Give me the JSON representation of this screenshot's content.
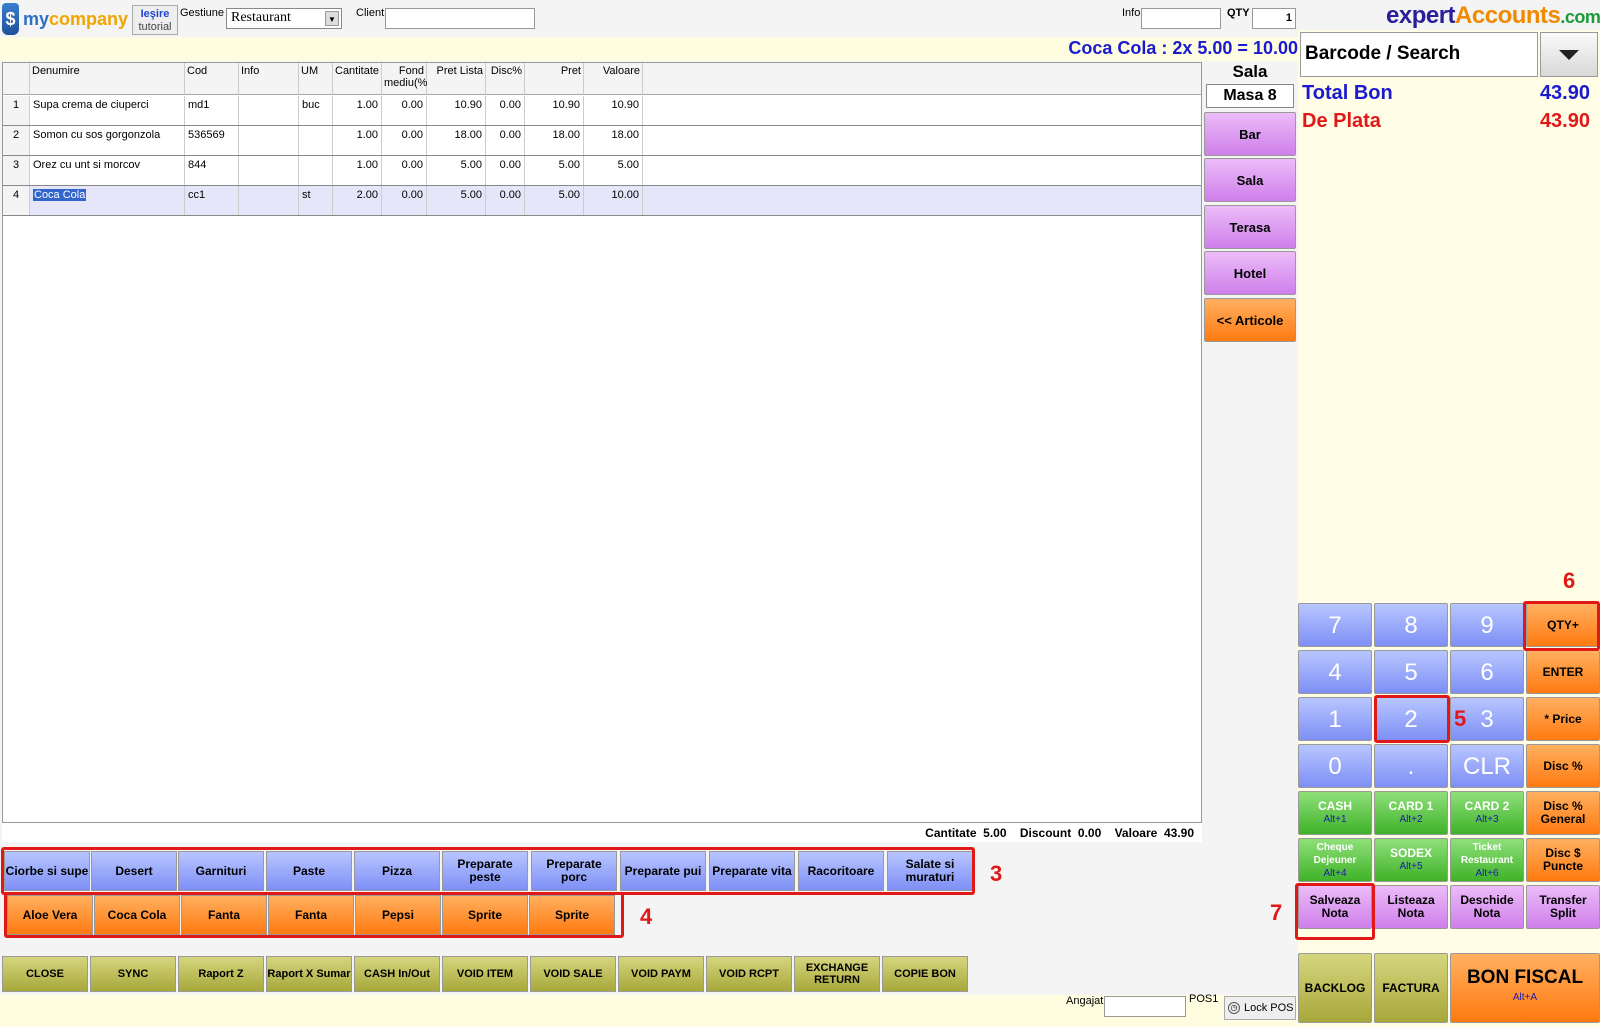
{
  "header": {
    "logo_text_a": "my",
    "logo_text_b": "company",
    "tutorial_line1": "Ieşire",
    "tutorial_line2": "tutorial",
    "gestiune_label": "Gestiune",
    "gestiune_value": "Restaurant",
    "client_label": "Client",
    "client_value": "",
    "info_label": "Info",
    "info_value": "",
    "qty_label": "QTY",
    "qty_value": "1",
    "brand_a": "expert",
    "brand_b": "Accounts",
    "brand_c": ".com",
    "last_item": "Coca Cola : 2x 5.00 = 10.00"
  },
  "grid": {
    "columns": [
      "Denumire",
      "Cod",
      "Info",
      "UM",
      "Cantitate",
      "Fond mediu(%",
      "Pret Lista",
      "Disc%",
      "Pret",
      "Valoare"
    ],
    "rows": [
      {
        "n": "1",
        "denumire": "Supa crema de ciuperci",
        "cod": "md1",
        "info": "",
        "um": "buc",
        "cant": "1.00",
        "fond": "0.00",
        "pret_lista": "10.90",
        "disc": "0.00",
        "pret": "10.90",
        "valoare": "10.90"
      },
      {
        "n": "2",
        "denumire": "Somon cu sos gorgonzola",
        "cod": "536569",
        "info": "",
        "um": "",
        "cant": "1.00",
        "fond": "0.00",
        "pret_lista": "18.00",
        "disc": "0.00",
        "pret": "18.00",
        "valoare": "18.00"
      },
      {
        "n": "3",
        "denumire": "Orez cu unt si morcov",
        "cod": "844",
        "info": "",
        "um": "",
        "cant": "1.00",
        "fond": "0.00",
        "pret_lista": "5.00",
        "disc": "0.00",
        "pret": "5.00",
        "valoare": "5.00"
      },
      {
        "n": "4",
        "denumire": "Coca Cola",
        "cod": "cc1",
        "info": "",
        "um": "st",
        "cant": "2.00",
        "fond": "0.00",
        "pret_lista": "5.00",
        "disc": "0.00",
        "pret": "5.00",
        "valoare": "10.00"
      }
    ],
    "footer": {
      "cant_label": "Cantitate",
      "cant": "5.00",
      "disc_label": "Discount",
      "disc": "0.00",
      "val_label": "Valoare",
      "val": "43.90"
    }
  },
  "sala": {
    "title": "Sala",
    "masa": "Masa 8",
    "buttons": [
      "Bar",
      "Sala",
      "Terasa",
      "Hotel"
    ],
    "articole": "<< Articole"
  },
  "search": {
    "label": "Barcode / Search"
  },
  "totals": {
    "total_label": "Total Bon",
    "total": "43.90",
    "plata_label": "De Plata",
    "plata": "43.90",
    "total_color": "#1a1ad0",
    "plata_color": "#e01818"
  },
  "keypad": {
    "digits": [
      "7",
      "8",
      "9",
      "4",
      "5",
      "6",
      "1",
      "2",
      "3",
      "0",
      ".",
      "CLR"
    ],
    "qty_plus": "QTY+",
    "enter": "ENTER",
    "price": "* Price",
    "disc_pct": "Disc %",
    "disc_general": "Disc % General",
    "disc_puncte": "Disc $ Puncte",
    "cash": "CASH",
    "cash_key": "Alt+1",
    "card1": "CARD 1",
    "card1_key": "Alt+2",
    "card2": "CARD 2",
    "card2_key": "Alt+3",
    "cheque": "Cheque Dejeuner",
    "cheque_key": "Alt+4",
    "sodex": "SODEX",
    "sodex_key": "Alt+5",
    "ticket": "Ticket Restaurant",
    "ticket_key": "Alt+6",
    "salveaza": "Salveaza Nota",
    "listeaza": "Listeaza Nota",
    "deschide": "Deschide Nota",
    "transfer": "Transfer Split",
    "backlog": "BACKLOG",
    "factura": "FACTURA",
    "bon_fiscal": "BON FISCAL",
    "bon_key": "Alt+A"
  },
  "categories": [
    "Ciorbe si supe",
    "Desert",
    "Garnituri",
    "Paste",
    "Pizza",
    "Preparate peste",
    "Preparate porc",
    "Preparate pui",
    "Preparate vita",
    "Racoritoare",
    "Salate si muraturi"
  ],
  "products": [
    "Aloe Vera",
    "Coca Cola",
    "Fanta",
    "Fanta",
    "Pepsi",
    "Sprite",
    "Sprite"
  ],
  "functions": [
    "CLOSE",
    "SYNC",
    "Raport Z",
    "Raport X Sumar",
    "CASH In/Out",
    "VOID ITEM",
    "VOID SALE",
    "VOID PAYM",
    "VOID RCPT",
    "EXCHANGE RETURN",
    "COPIE BON"
  ],
  "bottom": {
    "angajat_label": "Angajat",
    "angajat_value": "",
    "pos": "POS1",
    "lock": "Lock POS"
  },
  "markers": [
    "3",
    "4",
    "5",
    "6",
    "7"
  ]
}
